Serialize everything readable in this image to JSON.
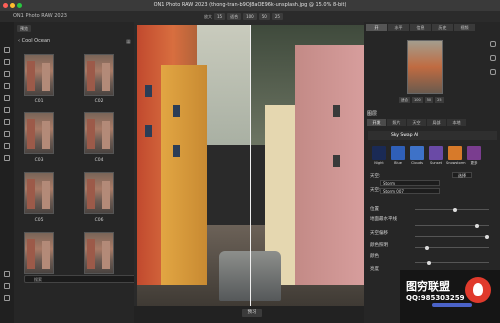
{
  "window": {
    "title": "ON1 Photo RAW 2023 (thong-tran-b9OJ8aOE96k-unsplash.jpg @ 15.0% 8-bit)",
    "app_name": "ON1 Photo RAW 2023"
  },
  "toolbar": {
    "zoom_label": "放大",
    "zoom_chips": [
      "15",
      "适合",
      "100",
      "50",
      "25"
    ]
  },
  "browser": {
    "tab_label": "预览",
    "folder": "‹ Cool Ocean",
    "thumbs": [
      "C01",
      "C02",
      "C03",
      "C04",
      "C05",
      "C06",
      "C07",
      "C08"
    ],
    "search_placeholder": "搜索"
  },
  "bottombar": {
    "preview_label": "预习"
  },
  "right_panel": {
    "tabs": [
      "开",
      "水平",
      "信息",
      "历史",
      "视频"
    ],
    "nav_zoom": [
      "适合",
      "100",
      "50",
      "25"
    ],
    "layers_title": "图层",
    "sub_tabs": [
      "开发",
      "照片",
      "天空",
      "局部",
      "本地"
    ],
    "filter_name": "Sky Swap AI",
    "filter_presets": [
      "Night",
      "Blue",
      "Clouds",
      "Sunset",
      "Snowstorm",
      "更多"
    ],
    "sky_label": "天空:",
    "sky_category": "Storm",
    "sky_image_label": "天空:",
    "sky_image": "Storm 007",
    "sky_btn": "选择",
    "rows": [
      "位置",
      "地面最水平线",
      "天空偏移",
      "颜色照明",
      "颜色",
      "亮度"
    ]
  },
  "watermark": {
    "line1": "图穷联盟",
    "line2": "QQ:985303259"
  },
  "colors": {
    "accent": "#3a6fd8",
    "panel": "#262626",
    "watermark_red": "#e03a2c"
  }
}
